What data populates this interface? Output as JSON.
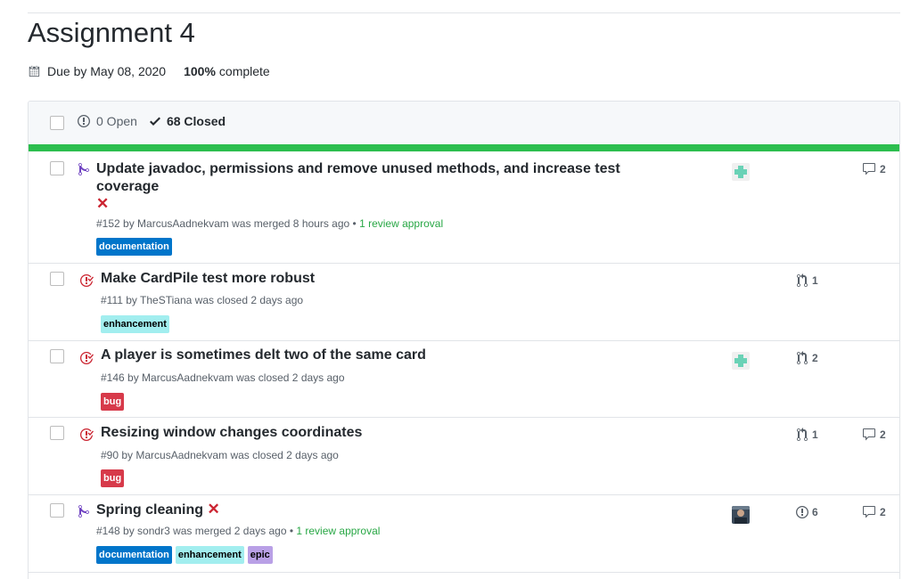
{
  "milestone": {
    "title": "Assignment 4",
    "due": "Due by May 08, 2020",
    "percent": "100%",
    "complete_label": "complete",
    "progress_fraction": 1.0
  },
  "states": {
    "open": "0 Open",
    "closed": "68 Closed"
  },
  "colors": {
    "progress": "#2cbe4e",
    "merged_icon": "#6f42c1",
    "closed_icon": "#cb2431",
    "review": "#28a745"
  },
  "items": [
    {
      "type_icon": "merged-pr-icon",
      "title_line1": "Update javadoc, permissions and remove unused methods, and increase test",
      "title_line2": "coverage",
      "status_mark": "✕",
      "number": "#152",
      "author": "MarcusAadnekvam",
      "action": "was merged 8 hours ago",
      "review": "1 review approval",
      "labels": [
        {
          "name": "documentation",
          "bg": "#0075ca",
          "fg": "#ffffff"
        }
      ],
      "avatar": "identicon-avatar",
      "comments": "2"
    },
    {
      "type_icon": "closed-issue-icon",
      "title": "Make CardPile test more robust",
      "number": "#111",
      "author": "TheSTiana",
      "action": "was closed 2 days ago",
      "labels": [
        {
          "name": "enhancement",
          "bg": "#a2eeef",
          "fg": "#000000"
        }
      ],
      "linked_prs": "1"
    },
    {
      "type_icon": "closed-issue-icon",
      "title": "A player is sometimes delt two of the same card",
      "number": "#146",
      "author": "MarcusAadnekvam",
      "action": "was closed 2 days ago",
      "labels": [
        {
          "name": "bug",
          "bg": "#d73a4a",
          "fg": "#ffffff"
        }
      ],
      "avatar": "identicon-avatar",
      "linked_prs": "2"
    },
    {
      "type_icon": "closed-issue-icon",
      "title": "Resizing window changes coordinates",
      "number": "#90",
      "author": "MarcusAadnekvam",
      "action": "was closed 2 days ago",
      "labels": [
        {
          "name": "bug",
          "bg": "#d73a4a",
          "fg": "#ffffff"
        }
      ],
      "linked_prs": "1",
      "comments": "2"
    },
    {
      "type_icon": "merged-pr-icon",
      "title": "Spring cleaning",
      "status_mark": "✕",
      "number": "#148",
      "author": "sondr3",
      "action": "was merged 2 days ago",
      "review": "1 review approval",
      "labels": [
        {
          "name": "documentation",
          "bg": "#0075ca",
          "fg": "#ffffff"
        },
        {
          "name": "enhancement",
          "bg": "#a2eeef",
          "fg": "#000000"
        },
        {
          "name": "epic",
          "bg": "#b9a0e6",
          "fg": "#000000"
        }
      ],
      "avatar": "photo-avatar",
      "linked_issues": "6",
      "comments": "2"
    }
  ]
}
